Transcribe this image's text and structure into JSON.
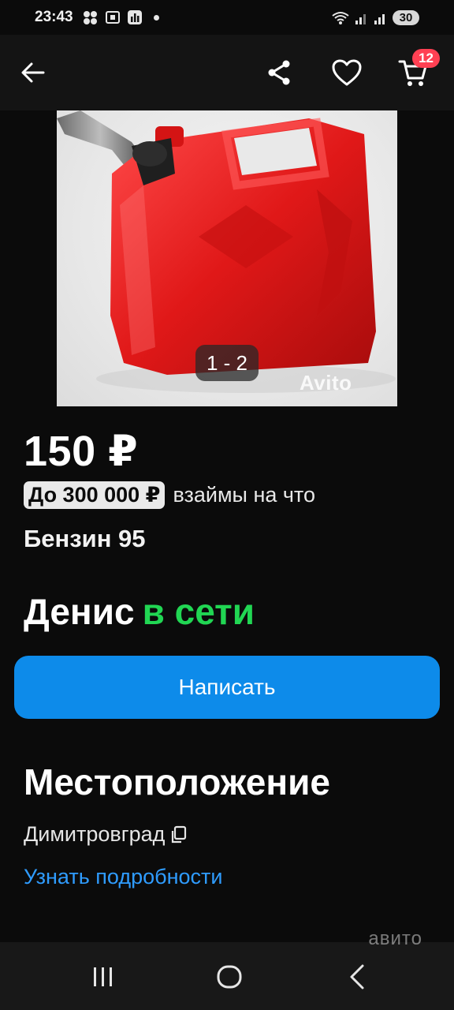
{
  "status_bar": {
    "time": "23:43",
    "battery": "30"
  },
  "app_bar": {
    "cart_count": "12"
  },
  "photo": {
    "counter": "1 - 2",
    "watermark": "Avito"
  },
  "listing": {
    "price": "150 ₽",
    "loan_chip": "До 300 000 ₽",
    "loan_text": "взаймы на что",
    "title": "Бензин 95"
  },
  "seller": {
    "name": "Денис",
    "status": "в сети"
  },
  "actions": {
    "write_label": "Написать"
  },
  "location": {
    "heading": "Местоположение",
    "city": "Димитровград",
    "details_link": "Узнать подробности"
  },
  "nav": {
    "watermark": "авито"
  },
  "colors": {
    "accent": "#0d8bea",
    "online": "#21d653",
    "link": "#2f9cff",
    "badge": "#ff4053"
  }
}
